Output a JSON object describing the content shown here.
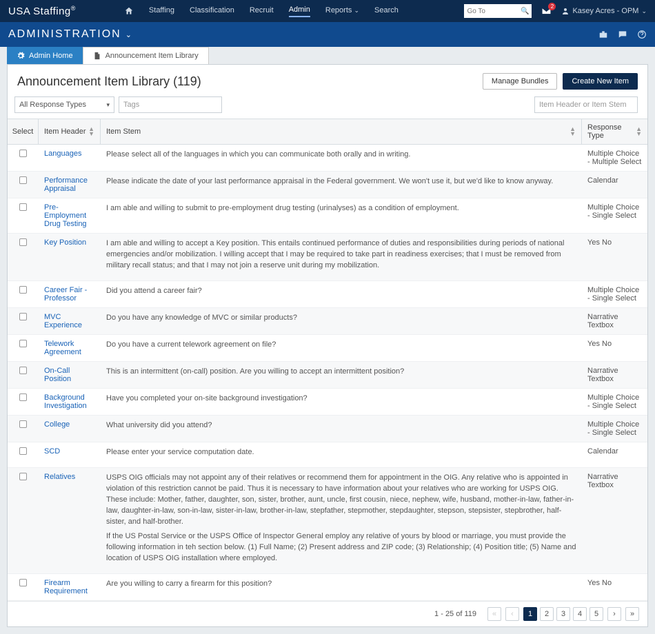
{
  "brand": "USA Staffing",
  "topnav": {
    "links": [
      "Staffing",
      "Classification",
      "Recruit",
      "Admin",
      "Reports",
      "Search"
    ],
    "active": "Admin",
    "goto_placeholder": "Go To",
    "mail_count": "2",
    "user": "Kasey Acres - OPM"
  },
  "subhead": {
    "title": "ADMINISTRATION"
  },
  "tabs": {
    "home": "Admin Home",
    "lib": "Announcement Item Library"
  },
  "panel": {
    "title": "Announcement Item Library (119)",
    "manage": "Manage Bundles",
    "create": "Create New Item"
  },
  "filters": {
    "response_types": "All Response Types",
    "tags_placeholder": "Tags",
    "search_placeholder": "Item Header or Item Stem"
  },
  "columns": {
    "select": "Select",
    "header": "Item Header",
    "stem": "Item Stem",
    "rt": "Response Type"
  },
  "rows": [
    {
      "header": "Languages",
      "stem": "Please select all of the languages in which you can communicate both orally and in writing.",
      "rt": "Multiple Choice - Multiple Select"
    },
    {
      "header": "Performance Appraisal",
      "stem": "Please indicate the date of your last performance appraisal in the Federal government. We won't use it, but we'd like to know anyway.",
      "rt": "Calendar"
    },
    {
      "header": "Pre-Employment Drug Testing",
      "stem": "I am able and willing to submit to pre-employment drug testing (urinalyses) as a condition of employment.",
      "rt": "Multiple Choice - Single Select"
    },
    {
      "header": "Key Position",
      "stem": "I am able and willing to accept a Key position. This entails continued performance of duties and responsibilities during periods of national emergencies and/or mobilization. I willing accept that I may be required to take part in readiness exercises; that I must be removed from military recall status; and that I may not join a reserve unit during my mobilization.",
      "rt": "Yes No"
    },
    {
      "header": "Career Fair - Professor",
      "stem": "Did you attend a career fair?",
      "rt": "Multiple Choice - Single Select"
    },
    {
      "header": "MVC Experience",
      "stem": "Do you have any knowledge of MVC or similar products?",
      "rt": "Narrative Textbox"
    },
    {
      "header": "Telework Agreement",
      "stem": "Do you have a current telework agreement on file?",
      "rt": "Yes No"
    },
    {
      "header": "On-Call Position",
      "stem": "This is an intermittent (on-call) position. Are you willing to accept an intermittent position?",
      "rt": "Narrative Textbox"
    },
    {
      "header": "Background Investigation",
      "stem": "Have you completed your on-site background investigation?",
      "rt": "Multiple Choice - Single Select"
    },
    {
      "header": "College",
      "stem": "What university did you attend?",
      "rt": "Multiple Choice - Single Select"
    },
    {
      "header": "SCD",
      "stem": "Please enter your service computation date.",
      "rt": "Calendar"
    },
    {
      "header": "Relatives",
      "stem": "USPS OIG officials may not appoint any of their relatives or recommend them for appointment in the OIG. Any relative who is appointed in violation of this restriction cannot be paid. Thus it is necessary to have information about your relatives who are working for USPS OIG. These include: Mother, father, daughter, son, sister, brother, aunt, uncle, first cousin, niece, nephew, wife, husband, mother-in-law, father-in-law, daughter-in-law, son-in-law, sister-in-law, brother-in-law, stepfather, stepmother, stepdaughter, stepson, stepsister, stepbrother, half-sister, and half-brother.\n\nIf the US Postal Service or the USPS Office of Inspector General employ any relative of yours by blood or marriage, you must provide the following information in teh section below. (1) Full Name; (2) Present address and ZIP code; (3) Relationship; (4) Position title; (5) Name and location of USPS OIG installation where employed.",
      "rt": "Narrative Textbox"
    },
    {
      "header": "Firearm Requirement",
      "stem": "Are you willing to carry a firearm for this position?",
      "rt": "Yes No"
    }
  ],
  "pager": {
    "info": "1 - 25 of 119",
    "pages": [
      "1",
      "2",
      "3",
      "4",
      "5"
    ],
    "active": "1"
  }
}
